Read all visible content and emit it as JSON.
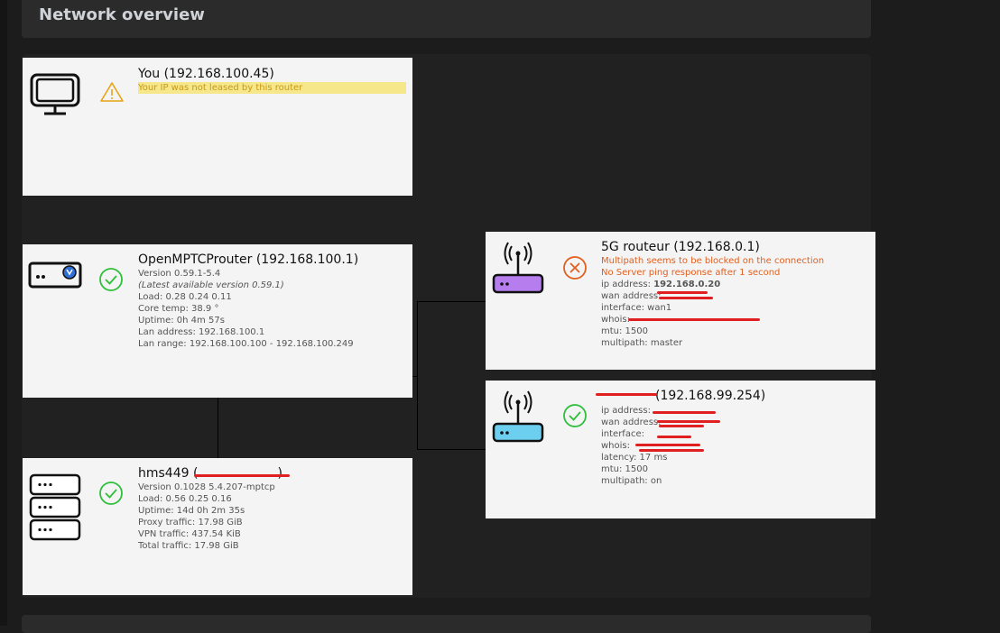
{
  "header": {
    "title": "Network overview"
  },
  "you": {
    "title": "You (192.168.100.45)",
    "warning": "Your IP was not leased by this router"
  },
  "router": {
    "title": "OpenMPTCProuter (192.168.100.1)",
    "version": "Version 0.59.1-5.4",
    "latest": "(Latest available version 0.59.1)",
    "load": "Load: 0.28 0.24 0.11",
    "core_temp": "Core temp: 38.9 °",
    "uptime": "Uptime: 0h 4m 57s",
    "lan_address": "Lan address: 192.168.100.1",
    "lan_range": "Lan range: 192.168.100.100 - 192.168.100.249"
  },
  "server": {
    "title": "hms449 (",
    "title_end": ")",
    "version": "Version 0.1028 5.4.207-mptcp",
    "load": "Load: 0.56 0.25 0.16",
    "uptime": "Uptime: 14d 0h 2m 35s",
    "proxy": "Proxy traffic: 17.98 GiB",
    "vpn": "VPN traffic: 437.54 KiB",
    "total": "Total traffic: 17.98 GiB"
  },
  "wan1": {
    "title": "5G routeur (192.168.0.1)",
    "error1": "Multipath seems to be blocked on the connection",
    "error2": "No Server ping response after 1 second",
    "ip_label": "ip address: ",
    "ip_value": "192.168.0.20",
    "wan_address": "wan address:",
    "interface": "interface: wan1",
    "whois": "whois:",
    "mtu": "mtu: 1500",
    "multipath": "multipath: master"
  },
  "wan2": {
    "title": "(192.168.99.254)",
    "ip_label": "ip address:",
    "wan_address": "wan address:",
    "interface": "interface:",
    "whois": "whois:",
    "latency": "latency: 17 ms",
    "mtu": "mtu: 1500",
    "multipath": "multipath: on"
  },
  "colors": {
    "warning_bg": "#f5e78a",
    "warning_icon": "#e8a317",
    "ok": "#2fbf3a",
    "error": "#e06020",
    "wan1_accent": "#b57ded",
    "wan2_accent": "#6ccff0"
  }
}
